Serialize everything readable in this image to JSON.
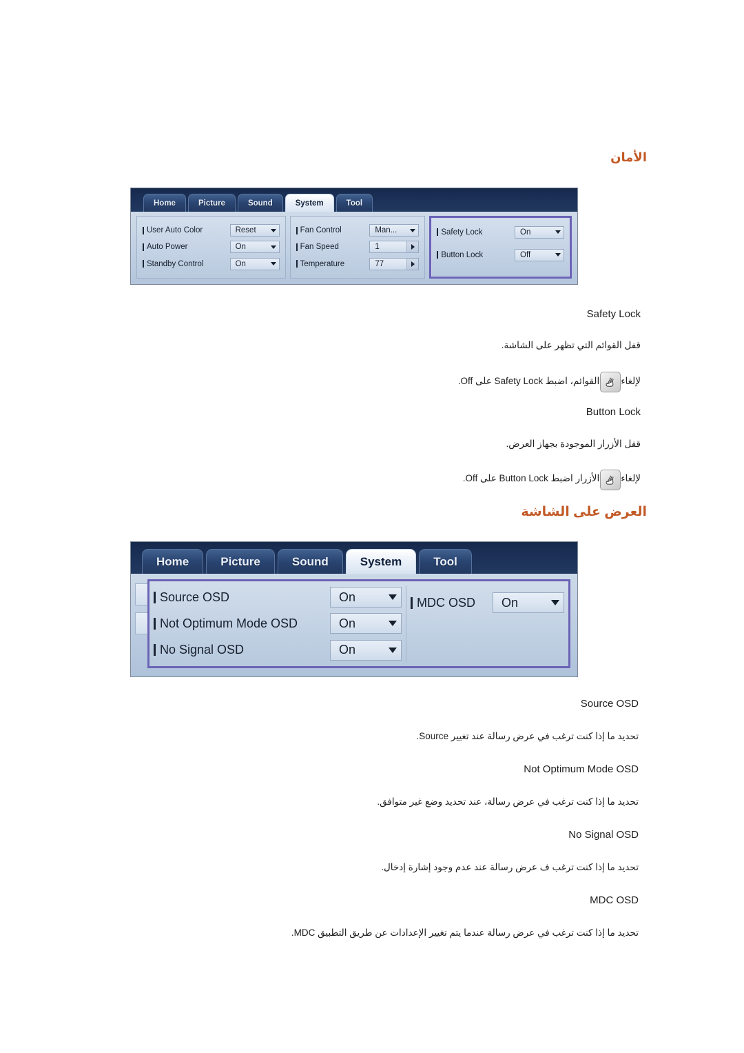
{
  "headings": {
    "security": "الأمان",
    "osd": "العرض على الشاشة"
  },
  "mdc_security_panel": {
    "tabs": [
      {
        "label": "Home",
        "active": false
      },
      {
        "label": "Picture",
        "active": false
      },
      {
        "label": "Sound",
        "active": false
      },
      {
        "label": "System",
        "active": true
      },
      {
        "label": "Tool",
        "active": false
      }
    ],
    "group_left": [
      {
        "label": "User Auto Color",
        "value": "Reset",
        "control": "dropdown"
      },
      {
        "label": "Auto Power",
        "value": "On",
        "control": "dropdown"
      },
      {
        "label": "Standby Control",
        "value": "On",
        "control": "dropdown"
      }
    ],
    "group_middle": [
      {
        "label": "Fan Control",
        "value": "Man...",
        "control": "dropdown"
      },
      {
        "label": "Fan Speed",
        "value": "1",
        "control": "spinner"
      },
      {
        "label": "Temperature",
        "value": "77",
        "control": "spinner"
      }
    ],
    "group_right": [
      {
        "label": "Safety Lock",
        "value": "On",
        "control": "dropdown"
      },
      {
        "label": "Button Lock",
        "value": "Off",
        "control": "dropdown"
      }
    ],
    "highlight_color": "#6b63b5"
  },
  "mdc_osd_panel": {
    "tabs": [
      {
        "label": "Home",
        "active": false
      },
      {
        "label": "Picture",
        "active": false
      },
      {
        "label": "Sound",
        "active": false
      },
      {
        "label": "System",
        "active": true
      },
      {
        "label": "Tool",
        "active": false
      }
    ],
    "column_left": [
      {
        "label": "Source OSD",
        "value": "On",
        "control": "dropdown"
      },
      {
        "label": "Not Optimum Mode OSD",
        "value": "On",
        "control": "dropdown"
      },
      {
        "label": "No Signal OSD",
        "value": "On",
        "control": "dropdown"
      }
    ],
    "column_right": [
      {
        "label": "MDC OSD",
        "value": "On",
        "control": "dropdown"
      }
    ],
    "highlight_color": "#6b63b5"
  },
  "security_section": {
    "safety_lock": {
      "term": "Safety Lock",
      "description": "قفل القوائم التي تظهر على الشاشة.",
      "note": "لإلغاء قفل القوائم، اضبط Safety Lock على Off."
    },
    "button_lock": {
      "term": "Button Lock",
      "description": "قفل الأزرار الموجودة بجهاز العرض.",
      "note": "لإلغاء قفل الأزرار اضبط Button Lock على Off."
    }
  },
  "osd_section": {
    "source_osd": {
      "term": "Source OSD",
      "description": "تحديد ما إذا كنت ترغب في عرض رسالة عند تغيير Source."
    },
    "not_optimum_mode_osd": {
      "term": "Not Optimum Mode OSD",
      "description": "تحديد ما إذا كنت ترغب في عرض رسالة، عند تحديد وضع غير متوافق."
    },
    "no_signal_osd": {
      "term": "No Signal OSD",
      "description": "تحديد ما إذا كنت ترغب ف عرض رسالة عند عدم وجود إشارة إدخال."
    },
    "mdc_osd": {
      "term": "MDC OSD",
      "description": "تحديد ما إذا كنت ترغب في عرض رسالة عندما يتم تغيير الإعدادات عن طريق التطبيق MDC."
    }
  },
  "icons": {
    "note_icon": "hand-note-icon"
  },
  "colors": {
    "heading": "#c25a26",
    "highlight_border": "#6b63b5",
    "tabbar_dark": "#1d3257",
    "panel_light": "#c6d4e6"
  }
}
